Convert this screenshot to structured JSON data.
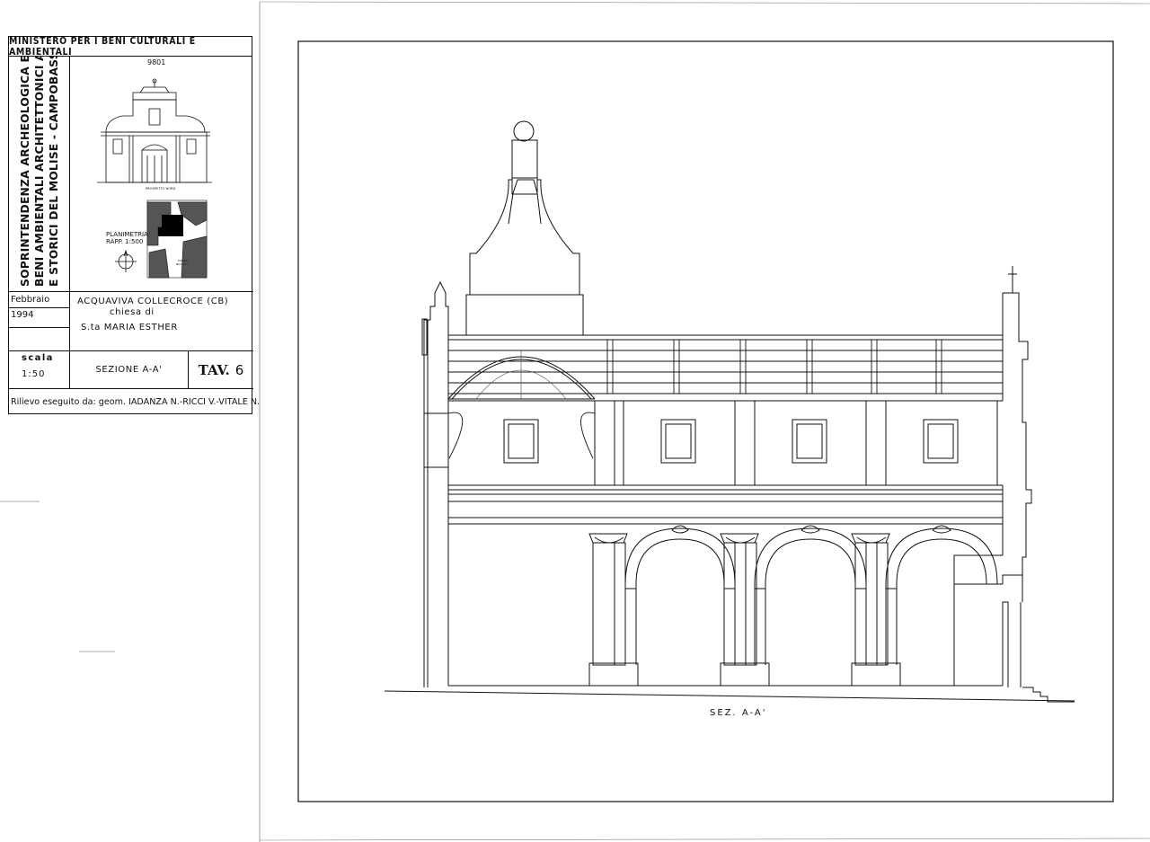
{
  "title_block": {
    "ministry": "MINISTERO PER I BENI CULTURALI E AMBIENTALI",
    "soprintendenza": [
      "SOPRINTENDENZA ARCHEOLOGICA E PER I",
      "BENI AMBIENTALI ARCHITETTONICI ARTISTICI",
      "E STORICI DEL MOLISE - CAMPOBASSO"
    ],
    "handwritten_note": "9801",
    "thumb_caption_elevation": "PROSPETTO NORD",
    "thumb_caption_plan": [
      "PLANIMETRIA",
      "RAPP. 1:500"
    ],
    "thumb_caption_square": [
      "PIAZZA",
      "NICOLA ..."
    ],
    "date": "Febbraio 1994",
    "location": "ACQUAVIVA COLLECROCE (CB)",
    "church_prefix": "chiesa di",
    "church_name": "S.ta MARIA ESTHER",
    "scale_label": "scala",
    "scale_value": "1:50",
    "section": "SEZIONE   A-A'",
    "tav_label": "TAV.",
    "tav_number": "6",
    "survey": "Rilievo eseguito da:  geom. IADANZA N.-RICCI V.-VITALE N."
  },
  "drawing": {
    "caption": "SEZ.  A-A'"
  }
}
